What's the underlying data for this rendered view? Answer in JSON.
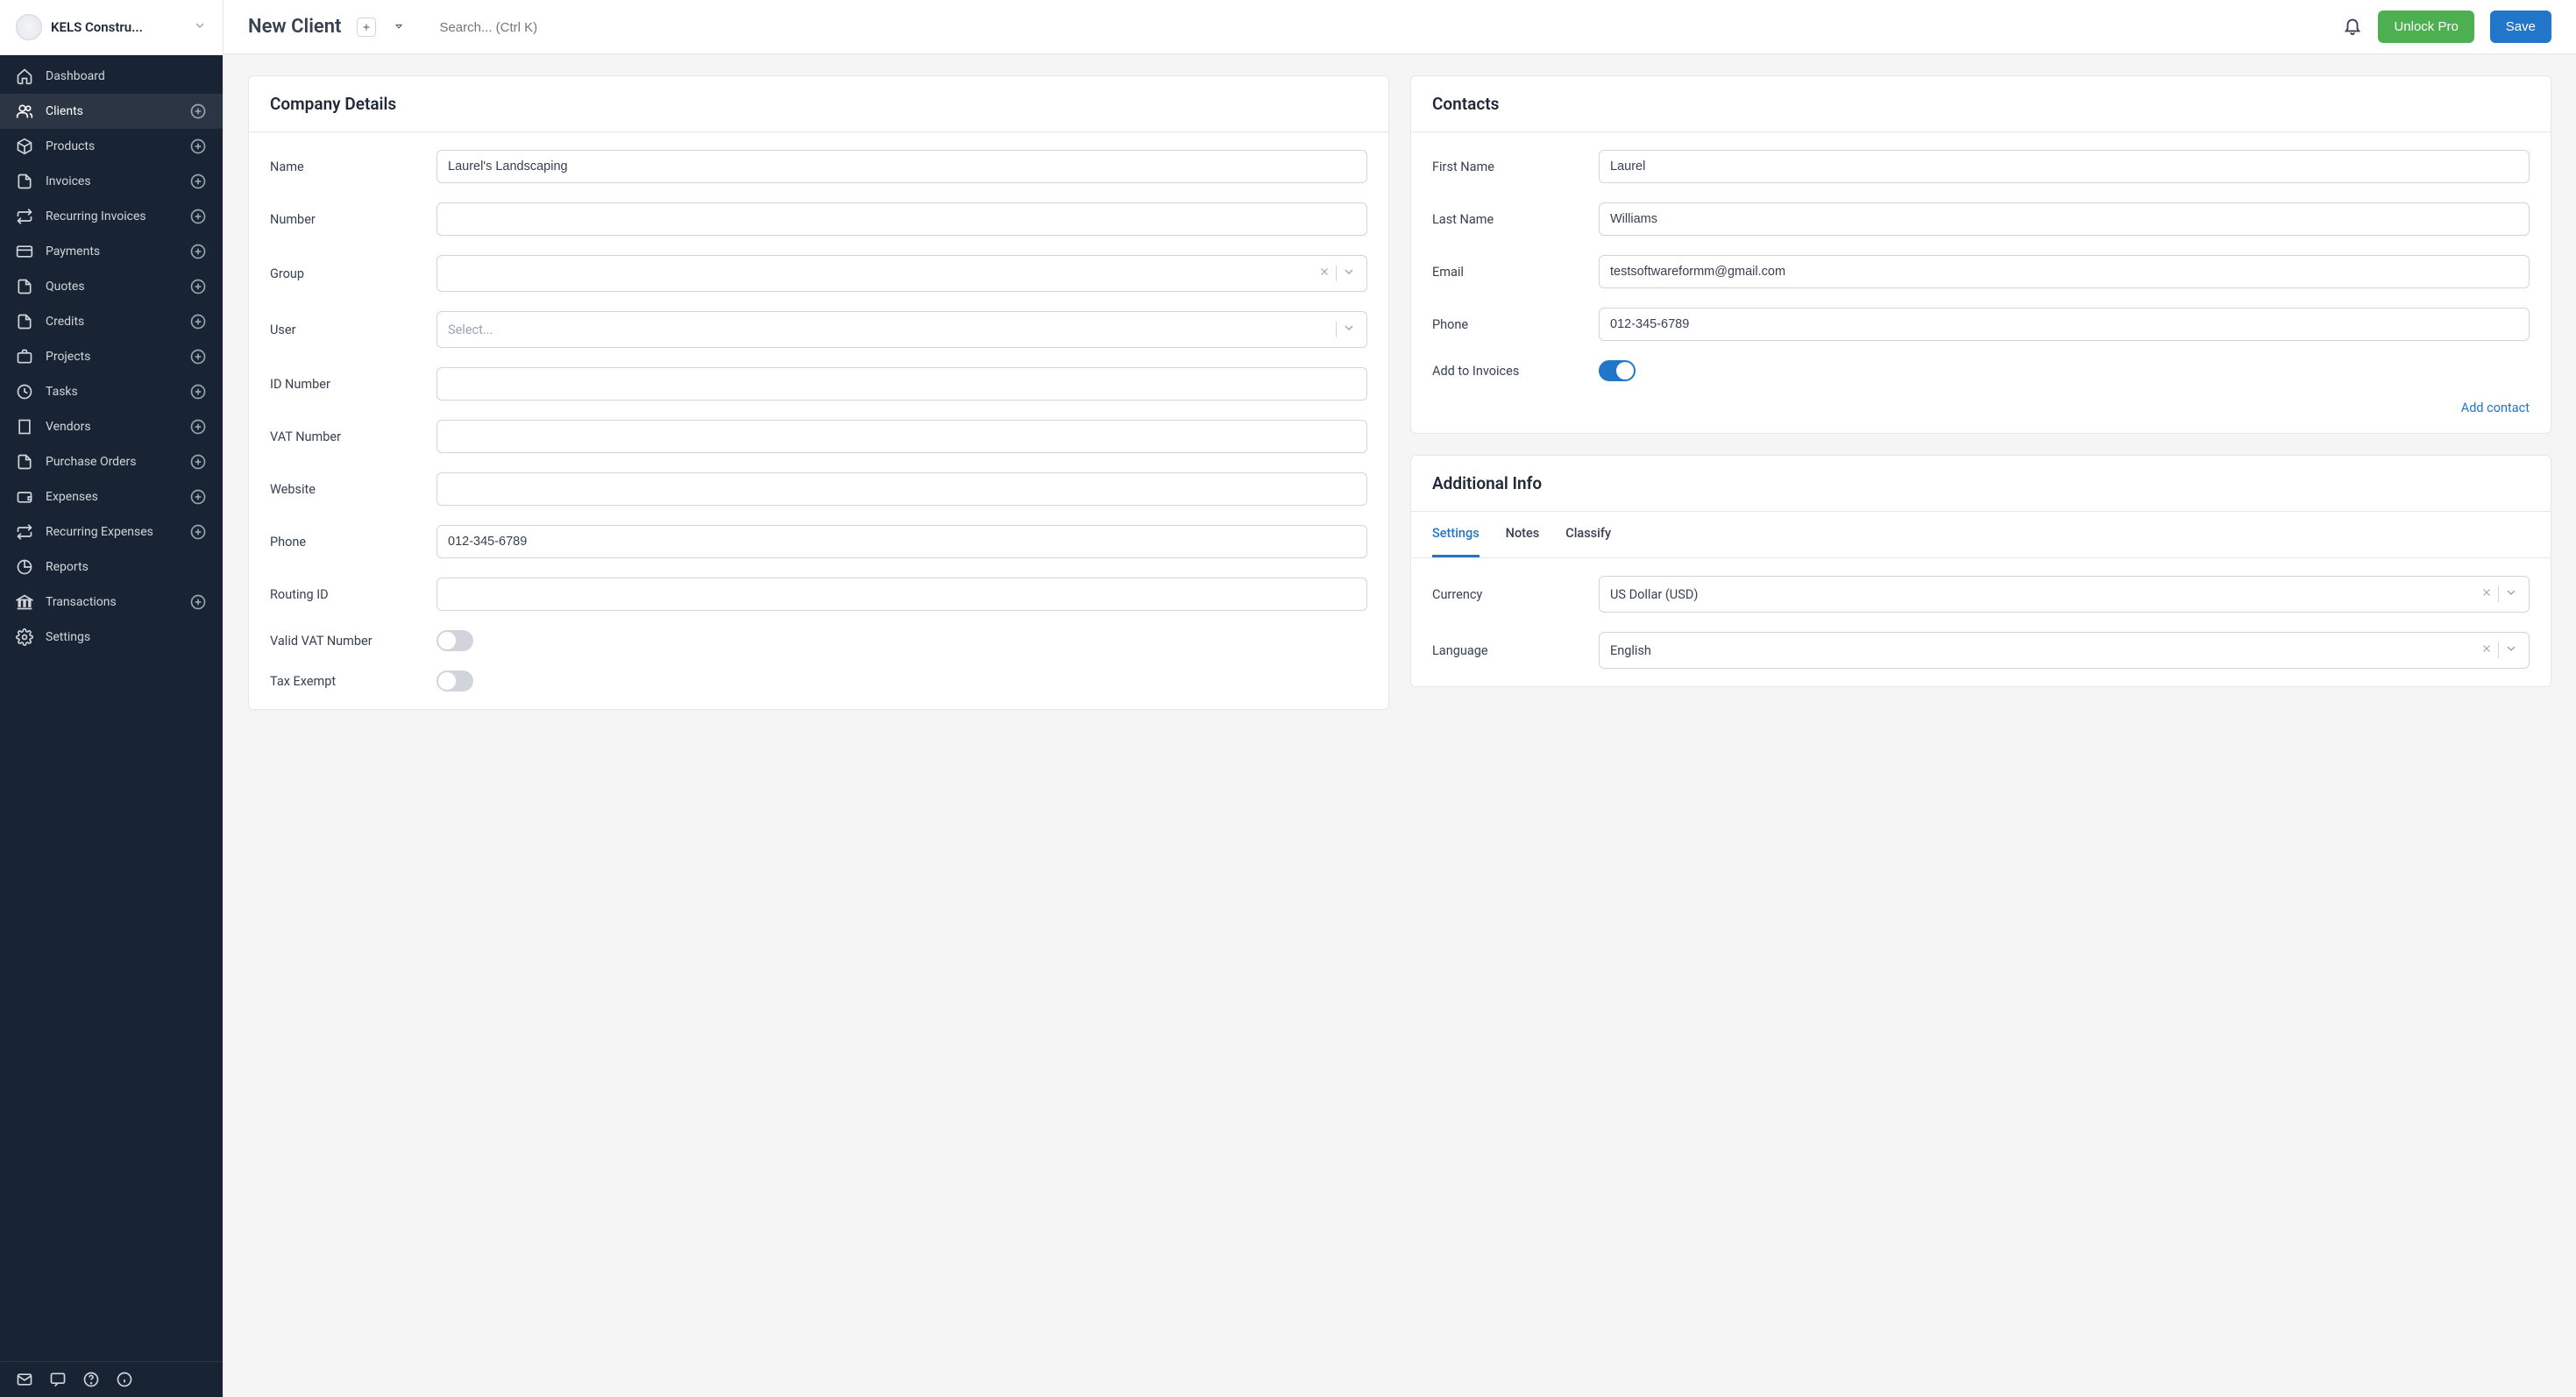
{
  "org": {
    "name": "KELS Constru..."
  },
  "header": {
    "title": "New Client",
    "search_placeholder": "Search... (Ctrl K)",
    "unlock_label": "Unlock Pro",
    "save_label": "Save"
  },
  "sidebar": {
    "items": [
      {
        "label": "Dashboard",
        "icon": "home",
        "add": false
      },
      {
        "label": "Clients",
        "icon": "users",
        "add": true,
        "active": true
      },
      {
        "label": "Products",
        "icon": "box",
        "add": true
      },
      {
        "label": "Invoices",
        "icon": "file",
        "add": true
      },
      {
        "label": "Recurring Invoices",
        "icon": "repeat",
        "add": true
      },
      {
        "label": "Payments",
        "icon": "card",
        "add": true
      },
      {
        "label": "Quotes",
        "icon": "file2",
        "add": true
      },
      {
        "label": "Credits",
        "icon": "file",
        "add": true
      },
      {
        "label": "Projects",
        "icon": "briefcase",
        "add": true
      },
      {
        "label": "Tasks",
        "icon": "clock",
        "add": true
      },
      {
        "label": "Vendors",
        "icon": "building",
        "add": true
      },
      {
        "label": "Purchase Orders",
        "icon": "file",
        "add": true
      },
      {
        "label": "Expenses",
        "icon": "wallet",
        "add": true
      },
      {
        "label": "Recurring Expenses",
        "icon": "repeat",
        "add": true
      },
      {
        "label": "Reports",
        "icon": "pie",
        "add": false
      },
      {
        "label": "Transactions",
        "icon": "bank",
        "add": true
      },
      {
        "label": "Settings",
        "icon": "gear",
        "add": false
      }
    ]
  },
  "company": {
    "heading": "Company Details",
    "fields": {
      "name_label": "Name",
      "name_value": "Laurel's Landscaping",
      "number_label": "Number",
      "number_value": "",
      "group_label": "Group",
      "group_value": "",
      "user_label": "User",
      "user_placeholder": "Select...",
      "idnum_label": "ID Number",
      "idnum_value": "",
      "vat_label": "VAT Number",
      "vat_value": "",
      "website_label": "Website",
      "website_value": "",
      "phone_label": "Phone",
      "phone_value": "012-345-6789",
      "routing_label": "Routing ID",
      "routing_value": "",
      "validvat_label": "Valid VAT Number",
      "taxexempt_label": "Tax Exempt"
    }
  },
  "contacts": {
    "heading": "Contacts",
    "first_label": "First Name",
    "first_value": "Laurel",
    "last_label": "Last Name",
    "last_value": "Williams",
    "email_label": "Email",
    "email_value": "testsoftwareformm@gmail.com",
    "phone_label": "Phone",
    "phone_value": "012-345-6789",
    "addinv_label": "Add to Invoices",
    "addcontact_label": "Add contact"
  },
  "additional": {
    "heading": "Additional Info",
    "tabs": {
      "settings": "Settings",
      "notes": "Notes",
      "classify": "Classify"
    },
    "currency_label": "Currency",
    "currency_value": "US Dollar (USD)",
    "language_label": "Language",
    "language_value": "English"
  }
}
